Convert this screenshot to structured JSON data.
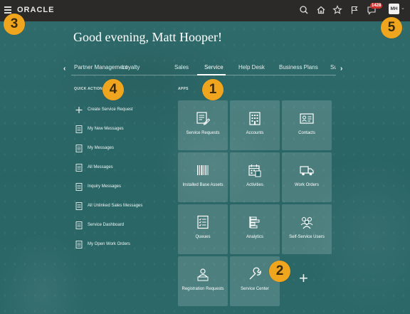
{
  "header": {
    "logo": "ORACLE",
    "notification_count": "1428",
    "avatar_initials": "MH"
  },
  "greeting": "Good evening, Matt Hooper!",
  "tabs": [
    {
      "label": "Partner Management"
    },
    {
      "label": "Loyalty"
    },
    {
      "label": "Sales"
    },
    {
      "label": "Service"
    },
    {
      "label": "Help Desk"
    },
    {
      "label": "Business Plans"
    },
    {
      "label": "Su"
    }
  ],
  "active_tab": "Service",
  "quick_actions": {
    "title": "QUICK ACTIONS",
    "items": [
      {
        "label": "Create Service Request",
        "icon": "plus-icon"
      },
      {
        "label": "My New Messages",
        "icon": "document-icon"
      },
      {
        "label": "My Messages",
        "icon": "document-icon"
      },
      {
        "label": "All Messages",
        "icon": "document-icon"
      },
      {
        "label": "Inquiry Messages",
        "icon": "document-icon"
      },
      {
        "label": "All Unlinked Sales Messages",
        "icon": "document-icon"
      },
      {
        "label": "Service Dashboard",
        "icon": "document-icon"
      },
      {
        "label": "My Open Work Orders",
        "icon": "document-icon"
      }
    ]
  },
  "apps": {
    "title": "APPS",
    "tiles": [
      {
        "label": "Service Requests",
        "icon": "service-request-icon"
      },
      {
        "label": "Accounts",
        "icon": "building-icon"
      },
      {
        "label": "Contacts",
        "icon": "contact-card-icon"
      },
      {
        "label": "Installed Base Assets",
        "icon": "barcode-icon"
      },
      {
        "label": "Activities",
        "icon": "calendar-icon"
      },
      {
        "label": "Work Orders",
        "icon": "truck-icon"
      },
      {
        "label": "Queues",
        "icon": "checklist-icon"
      },
      {
        "label": "Analytics",
        "icon": "analytics-icon"
      },
      {
        "label": "Self-Service Users",
        "icon": "users-icon"
      },
      {
        "label": "Registration Requests",
        "icon": "registration-icon"
      },
      {
        "label": "Service Center",
        "icon": "wrench-icon"
      }
    ]
  },
  "callouts": [
    "1",
    "2",
    "3",
    "4",
    "5"
  ],
  "colors": {
    "topbar": "#2b2a28",
    "background": "#2d6868",
    "callout": "#f0a51e",
    "badge": "#d0312d"
  }
}
